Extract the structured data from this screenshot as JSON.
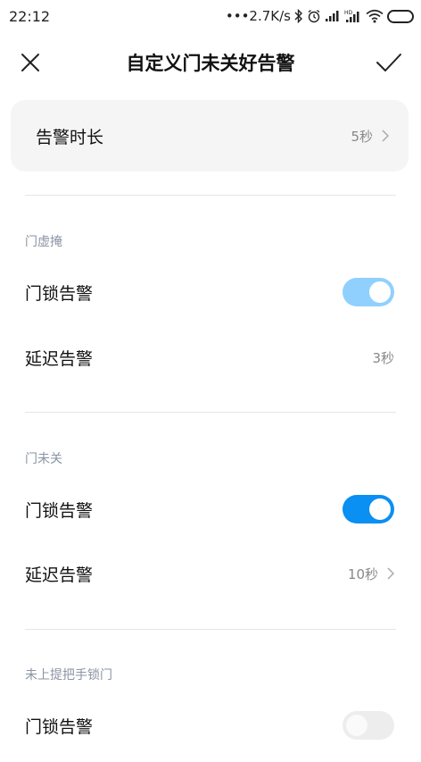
{
  "status_bar": {
    "time": "22:12",
    "network_speed": "•••2.7K/s",
    "icons": [
      "bluetooth-icon",
      "alarm-icon",
      "signal-icon",
      "hd-signal-icon",
      "wifi-icon",
      "battery-icon"
    ]
  },
  "header": {
    "title": "自定义门未关好告警",
    "close_icon": "close-icon",
    "confirm_icon": "check-icon"
  },
  "alert_duration": {
    "label": "告警时长",
    "value": "5秒"
  },
  "sections": [
    {
      "title": "门虚掩",
      "lock_alert_label": "门锁告警",
      "lock_alert_state": "on-dimmed",
      "delay_label": "延迟告警",
      "delay_value": "3秒"
    },
    {
      "title": "门未关",
      "lock_alert_label": "门锁告警",
      "lock_alert_state": "on",
      "delay_label": "延迟告警",
      "delay_value": "10秒"
    },
    {
      "title": "未上提把手锁门",
      "lock_alert_label": "门锁告警",
      "lock_alert_state": "off"
    }
  ],
  "colors": {
    "accent": "#0a8ff3",
    "accent_dimmed": "#8fd0ff",
    "section_title": "#8a93a3",
    "card_bg": "#f5f5f5"
  }
}
